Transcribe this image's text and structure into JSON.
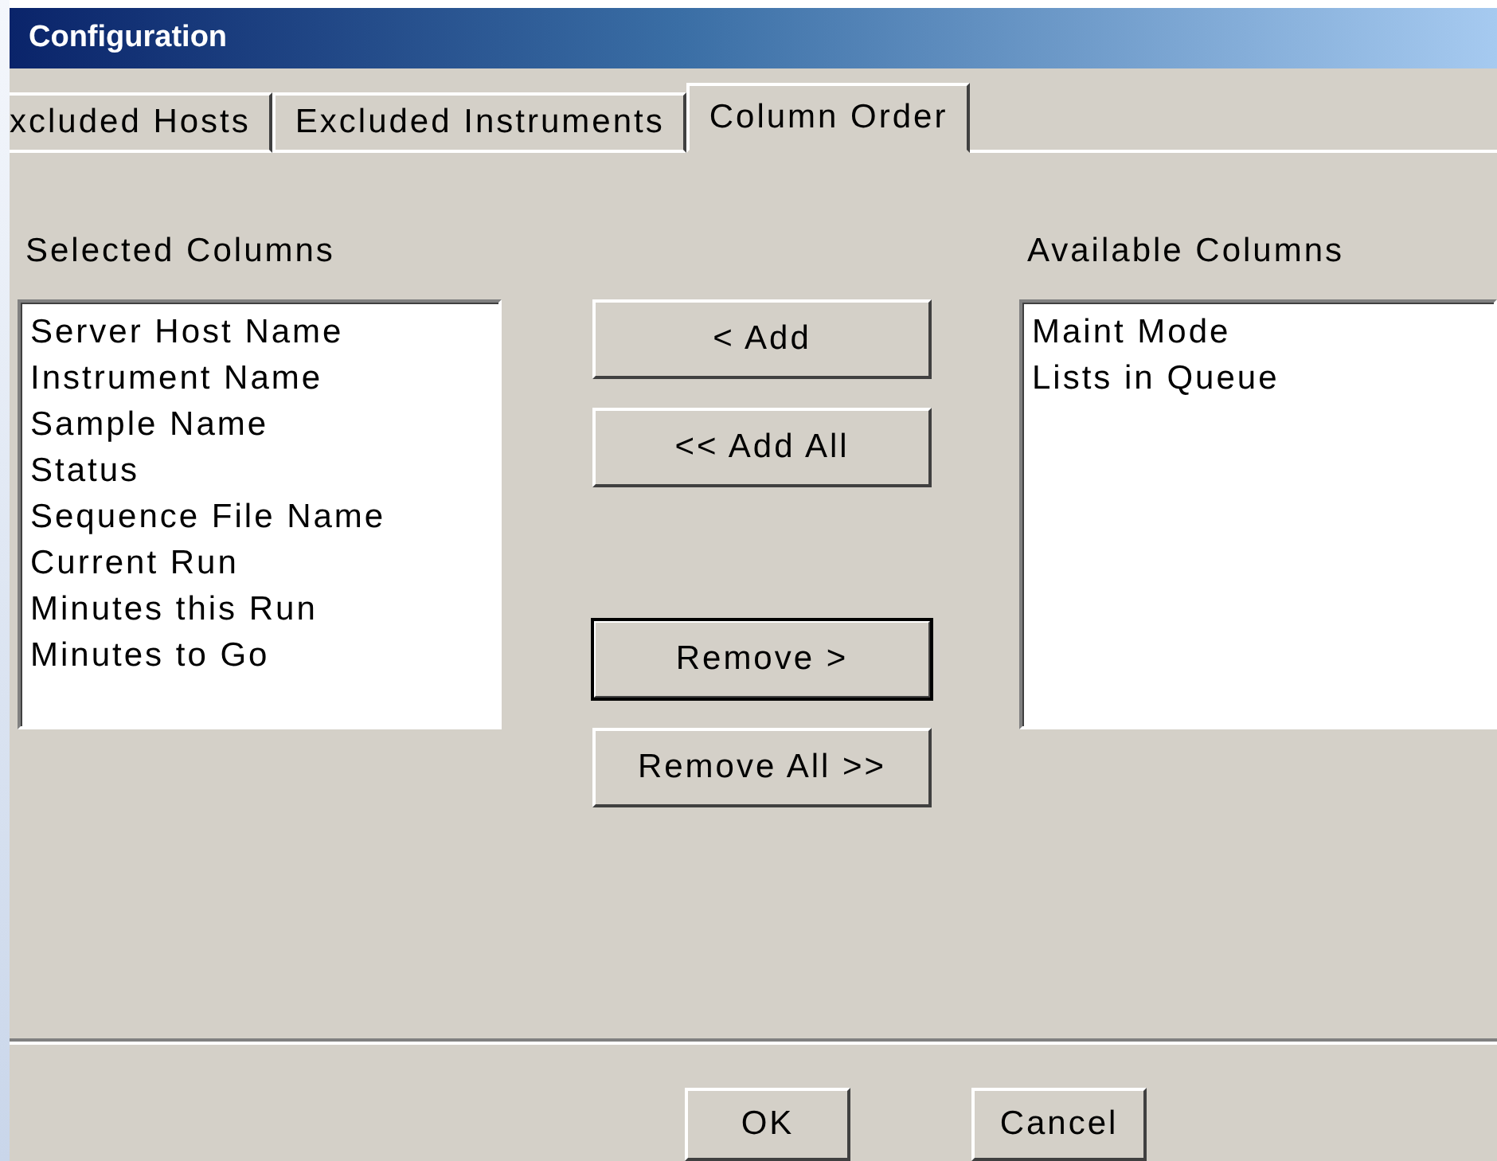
{
  "window": {
    "title": "Configuration"
  },
  "tabs": [
    {
      "label": "xcluded Hosts",
      "selected": false
    },
    {
      "label": "Excluded Instruments",
      "selected": false
    },
    {
      "label": "Column Order",
      "selected": true
    }
  ],
  "selected_columns": {
    "label": "Selected Columns",
    "items": [
      "Server Host Name",
      "Instrument Name",
      "Sample Name",
      "Status",
      "Sequence File Name",
      "Current Run",
      "Minutes this Run",
      "Minutes to Go"
    ]
  },
  "move_buttons": [
    {
      "label": "< Add",
      "default": false
    },
    {
      "label": "<< Add All",
      "default": false
    },
    {
      "label": "Remove >",
      "default": true
    },
    {
      "label": "Remove All >>",
      "default": false
    }
  ],
  "available_columns": {
    "label": "Available Columns",
    "items": [
      "Maint Mode",
      "Lists in Queue"
    ]
  },
  "buttons": [
    "OK",
    "Cancel"
  ]
}
